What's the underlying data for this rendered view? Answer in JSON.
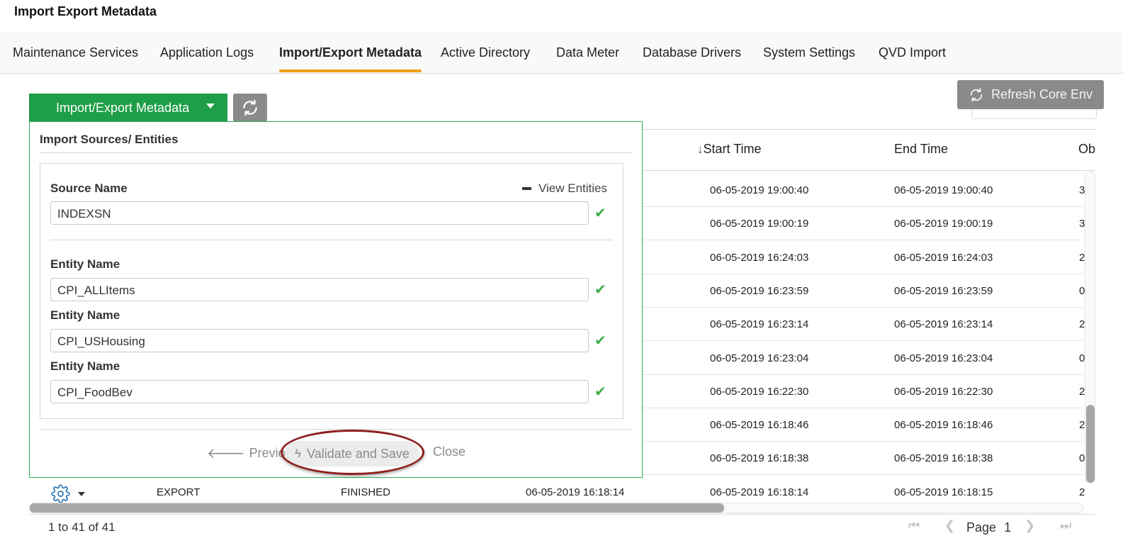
{
  "page_title": "Import Export Metadata",
  "tabs": [
    {
      "label": "Maintenance Services"
    },
    {
      "label": "Application Logs"
    },
    {
      "label": "Import/Export Metadata",
      "active": true
    },
    {
      "label": "Active Directory"
    },
    {
      "label": "Data Meter"
    },
    {
      "label": "Database Drivers"
    },
    {
      "label": "System Settings"
    },
    {
      "label": "QVD Import"
    }
  ],
  "toolbar": {
    "dropdown_label": "Import/Export Metadata",
    "refresh_core_label": "Refresh Core Env"
  },
  "panel": {
    "title": "Import Sources/ Entities",
    "source_label": "Source Name",
    "source_value": "INDEXSN",
    "view_entities_label": "View Entities",
    "entities": [
      {
        "label": "Entity Name",
        "value": "CPI_ALLItems"
      },
      {
        "label": "Entity Name",
        "value": "CPI_USHousing"
      },
      {
        "label": "Entity Name",
        "value": "CPI_FoodBev"
      }
    ],
    "previous_label": "Previous",
    "validate_label": "Validate and Save",
    "close_label": "Close"
  },
  "table": {
    "columns": {
      "start": "Start Time",
      "end": "End Time",
      "obj": "Ob"
    },
    "rows": [
      {
        "start": "06-05-2019 19:00:40",
        "end": "06-05-2019 19:00:40",
        "obj": "3"
      },
      {
        "start": "06-05-2019 19:00:19",
        "end": "06-05-2019 19:00:19",
        "obj": "3"
      },
      {
        "start": "06-05-2019 16:24:03",
        "end": "06-05-2019 16:24:03",
        "obj": "2"
      },
      {
        "start": "06-05-2019 16:23:59",
        "end": "06-05-2019 16:23:59",
        "obj": "0"
      },
      {
        "start": "06-05-2019 16:23:14",
        "end": "06-05-2019 16:23:14",
        "obj": "2"
      },
      {
        "start": "06-05-2019 16:23:04",
        "end": "06-05-2019 16:23:04",
        "obj": "0"
      },
      {
        "start": "06-05-2019 16:22:30",
        "end": "06-05-2019 16:22:30",
        "obj": "2"
      },
      {
        "start": "06-05-2019 16:18:46",
        "end": "06-05-2019 16:18:46",
        "obj": "2"
      },
      {
        "start": "06-05-2019 16:18:38",
        "end": "06-05-2019 16:18:38",
        "obj": "0"
      }
    ],
    "last_row": {
      "type": "EXPORT",
      "status": "FINISHED",
      "created": "06-05-2019 16:18:14",
      "start": "06-05-2019 16:18:14",
      "end": "06-05-2019 16:18:15",
      "obj": "2"
    }
  },
  "pagination": {
    "count_text": "1 to 41 of 41",
    "page_label": "Page",
    "page_number": "1"
  },
  "colors": {
    "primary_green": "#1e9e47",
    "tab_underline": "#f0a019",
    "check_green": "#3fae49",
    "highlight_ring": "#8e1f1f"
  }
}
